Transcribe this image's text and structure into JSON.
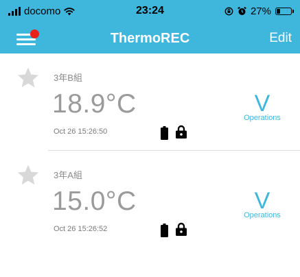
{
  "status_bar": {
    "carrier": "docomo",
    "time": "23:24",
    "battery_percent": "27%",
    "battery_level": 0.27,
    "icons": [
      "signal-icon",
      "wifi-icon",
      "orientation-lock-icon",
      "alarm-icon",
      "battery-icon"
    ]
  },
  "nav": {
    "title": "ThermoREC",
    "edit_label": "Edit",
    "menu_icon": "menu-icon",
    "notification_color": "#e8211a"
  },
  "colors": {
    "accent": "#3fb6dc",
    "temperature_text": "#9a9a9a",
    "star": "#d8d8d8"
  },
  "devices": [
    {
      "name": "3年B組",
      "temperature": "18.9°C",
      "timestamp": "Oct 26 15:26:50",
      "ops_symbol": "V",
      "ops_label": "Operations",
      "favorite": false
    },
    {
      "name": "3年A組",
      "temperature": "15.0°C",
      "timestamp": "Oct 26 15:26:52",
      "ops_symbol": "V",
      "ops_label": "Operations",
      "favorite": false
    }
  ]
}
